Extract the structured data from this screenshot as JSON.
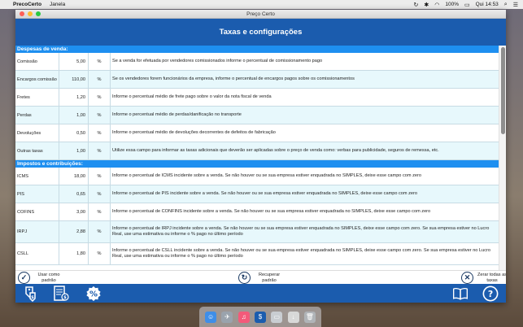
{
  "menubar": {
    "app_name": "PrecoCerto",
    "menu_item": "Janela",
    "battery": "100%",
    "clock": "Qui 14:53"
  },
  "window": {
    "title": "Preço Certo",
    "header": "Taxas e configurações"
  },
  "sections": [
    {
      "title": "Despesas de venda:",
      "rows": [
        {
          "name": "Comissão",
          "value": "5,00",
          "unit": "%",
          "desc": "Se a venda for efetuada por vendedores comissionados informe o percentual de comissionamento pago"
        },
        {
          "name": "Encargos comissão",
          "value": "110,00",
          "unit": "%",
          "desc": "Se os vendedores forem funcionários da empresa, informe o percentual de encargos pagos sobre os comissionamentos"
        },
        {
          "name": "Fretes",
          "value": "1,20",
          "unit": "%",
          "desc": "Informe o percentual médio de frete pago sobre o valor da nota fiscal de venda"
        },
        {
          "name": "Perdas",
          "value": "1,00",
          "unit": "%",
          "desc": "Informe o percentual médio de perdas/danificação no transporte"
        },
        {
          "name": "Devoluções",
          "value": "0,50",
          "unit": "%",
          "desc": "Informe o percentual médio de devoluções decorrentes de defeitos de fabricação"
        },
        {
          "name": "Outras taxas",
          "value": "1,00",
          "unit": "%",
          "desc": "Utilize essa campo para informar as taxas adicionais que deverão ser aplicadas sobre o preço de venda como: verbas para publicidade, seguros de remessa, etc."
        }
      ]
    },
    {
      "title": "Impostos e contribuições:",
      "rows": [
        {
          "name": "ICMS",
          "value": "18,00",
          "unit": "%",
          "desc": "Informe o percentual de ICMS incidente sobre a venda. Se não houver ou se sua empresa estiver enquadrada no SIMPLES, deixe esse campo com zero"
        },
        {
          "name": "PIS",
          "value": "0,65",
          "unit": "%",
          "desc": "Informe o percentual de PIS incidente sobre a venda. Se não houver ou se sua empresa estiver enquadrada no SIMPLES, deixe esse campo com zero"
        },
        {
          "name": "COFINS",
          "value": "3,00",
          "unit": "%",
          "desc": "Informe o percentual de CONFINS incidente sobre a venda. Se não houver ou se sua empresa estiver enquadrada no SIMPLES, deixe esse campo com zero"
        },
        {
          "name": "IRPJ",
          "value": "2,88",
          "unit": "%",
          "desc": "Informe o percentual de IRPJ incidente sobre a venda. Se não houver ou se sua empresa estiver enquadrada no SIMPLES, deixe esse campo com zero. Se sua empresa estiver no Lucro Real, use uma estimativa ou informe o % pago no último período"
        },
        {
          "name": "CSLL",
          "value": "1,80",
          "unit": "%",
          "desc": "Informe o percentual de CSLL incidente sobre a venda. Se não houver ou se sua empresa estiver enquadrada no SIMPLES, deixe esse campo com zero. Se sua empresa estiver no Lucro Real, use uma estimativa ou informe o % pago no último período"
        }
      ]
    }
  ],
  "actions": {
    "use_default": "Usar como padrão",
    "recover_default": "Recuperar padrão",
    "reset_all": "Zerar todas as taxas"
  },
  "icons": {
    "bottom_left": [
      "price-tags-icon",
      "invoice-list-icon",
      "percent-badge-icon"
    ],
    "bottom_right": [
      "book-icon",
      "help-icon"
    ]
  },
  "colors": {
    "header_blue": "#1b5cae",
    "section_blue": "#1e8ff0",
    "row_tint": "#e7f8fc"
  }
}
